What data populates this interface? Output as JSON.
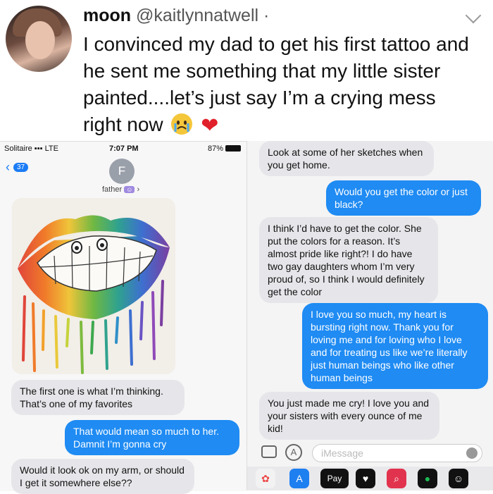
{
  "tweet": {
    "name": "moon",
    "handle": "@kaitlynnatwell",
    "dot": "·",
    "text": "I convinced my dad to get his first tattoo and he sent me something that my little sister painted....let’s just say I’m a crying mess right now",
    "emoji_1": "crying-face",
    "emoji_2": "❤"
  },
  "left_phone": {
    "status_left": "Solitaire",
    "status_network": "LTE",
    "status_time": "7:07 PM",
    "status_battery": "87%",
    "back_count": "37",
    "contact_initial": "F",
    "contact_name": "father",
    "messages": [
      {
        "type": "received",
        "text": "The first one is what I’m thinking. That’s one of my favorites"
      },
      {
        "type": "sent",
        "text": "That would mean so much to her. Damnit I’m gonna cry"
      },
      {
        "type": "received",
        "text": "Would it look ok on my arm, or should I get it somewhere else??"
      }
    ]
  },
  "right_phone": {
    "messages": [
      {
        "type": "received",
        "text": "Look at some of her sketches when you get home."
      },
      {
        "type": "sent",
        "text": "Would you get the color or just black?"
      },
      {
        "type": "received",
        "text": "I think I’d have to get the color. She put the colors for a reason. It’s almost pride like right?! I do have two gay daughters whom I’m very proud of, so I think I would definitely get the color"
      },
      {
        "type": "sent",
        "text": "I love you so much, my heart is bursting right now. Thank you for loving me and for loving who I love and for treating us like we’re literally just human beings who like other human beings"
      },
      {
        "type": "received",
        "text": "You just made me cry! I love you and your sisters with every ounce of me kid!"
      }
    ],
    "input_placeholder": "iMessage",
    "dock_pay": "Pay"
  },
  "colors": {
    "imessage_blue": "#1f8bf3",
    "received_gray": "#e6e6ea"
  }
}
